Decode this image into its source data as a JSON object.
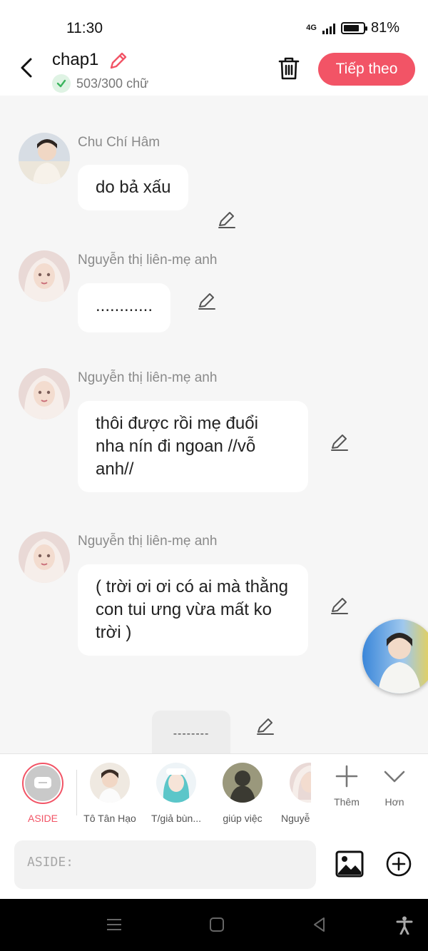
{
  "status_bar": {
    "time": "11:30",
    "network": "4G",
    "battery": "81%",
    "battery_level": 0.81
  },
  "header": {
    "title": "chap1",
    "word_count": "503/300 chữ",
    "next_label": "Tiếp theo"
  },
  "messages": [
    {
      "name": "Chu Chí Hâm",
      "text": "do bả xấu"
    },
    {
      "name": "Nguyễn thị liên-mẹ anh",
      "text": "............"
    },
    {
      "name": "Nguyễn thị liên-mẹ anh",
      "text": "thôi được rồi mẹ đuổi nha nín đi ngoan //vỗ anh//"
    },
    {
      "name": "Nguyễn thị liên-mẹ anh",
      "text": "( trời ơi ơi có ai mà thằng con tui ưng vừa mất ko trời )"
    }
  ],
  "aside_message": {
    "text": "--------"
  },
  "characters": [
    {
      "label": "ASIDE",
      "selected": true
    },
    {
      "label": "Tô Tân Hạo"
    },
    {
      "label": "T/giả bùn..."
    },
    {
      "label": "giúp việc"
    },
    {
      "label": "Nguyễ"
    }
  ],
  "tools": {
    "add_label": "Thêm",
    "more_label": "Hơn"
  },
  "input": {
    "placeholder": "ASIDE:"
  },
  "colors": {
    "accent": "#f25466",
    "check_green": "#3bb55e"
  }
}
